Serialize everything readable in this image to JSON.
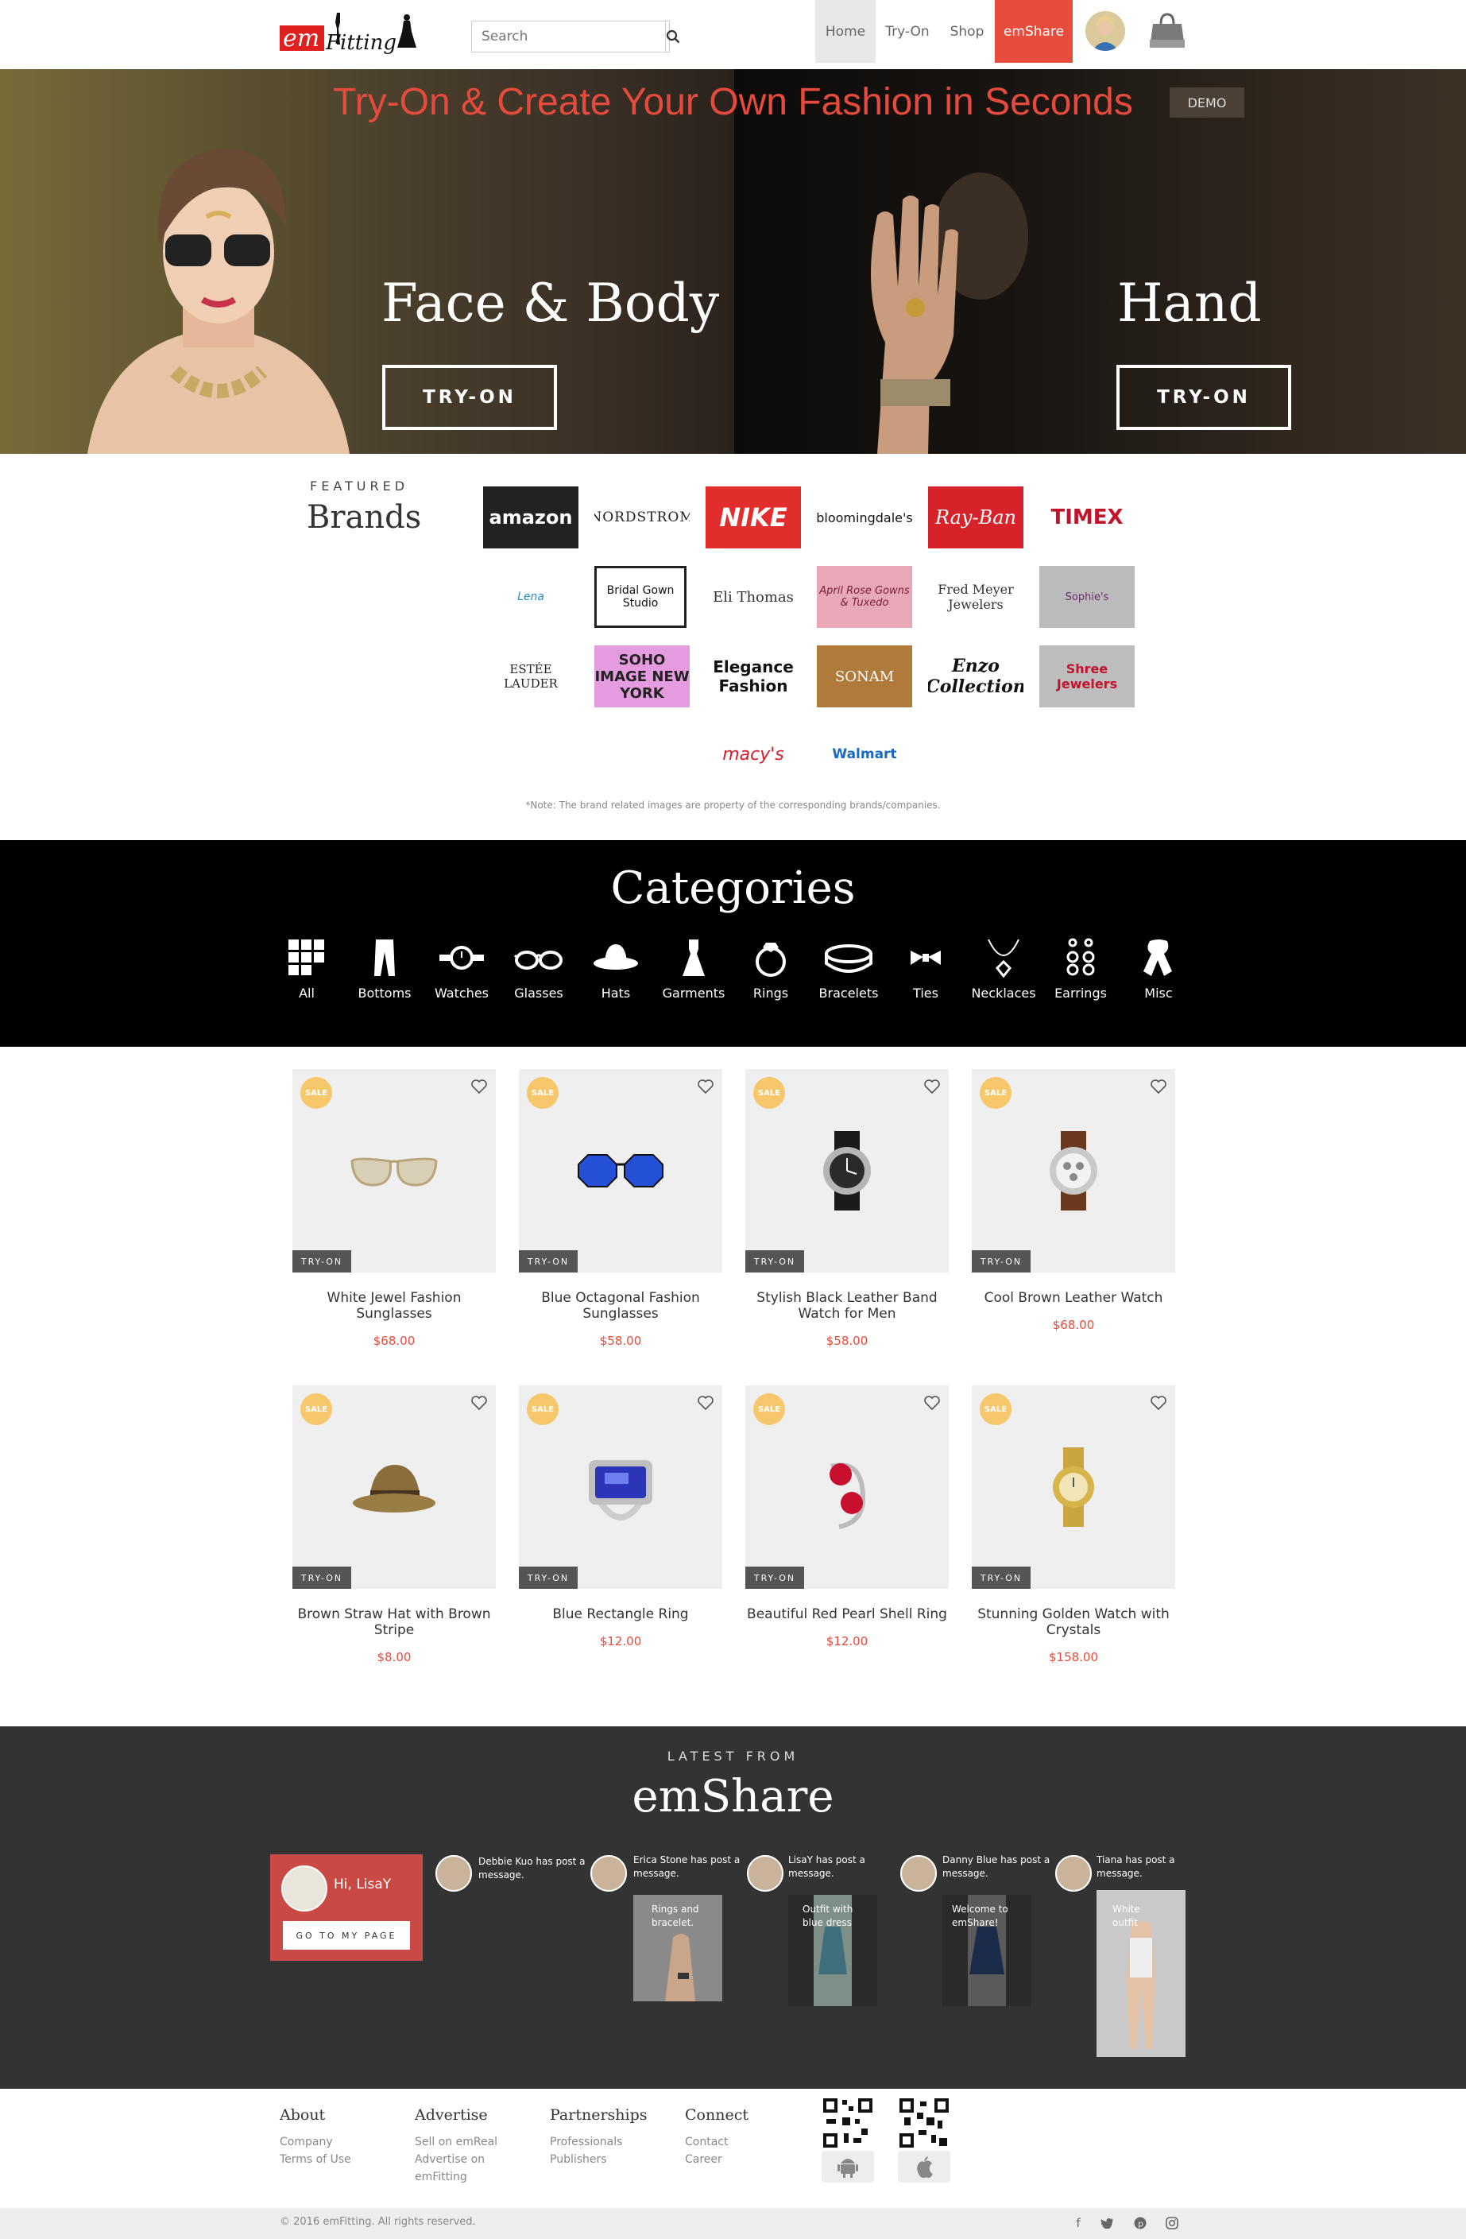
{
  "header": {
    "logo_text_a": "em",
    "logo_text_b": "Fitting",
    "search_placeholder": "Search",
    "nav": [
      "Home",
      "Try-On",
      "Shop",
      "emShare"
    ],
    "active_nav": "Home",
    "accent": "#e74c3c"
  },
  "hero": {
    "title": "Try-On & Create Your Own Fashion in Seconds",
    "demo": "DEMO",
    "left_heading": "Face & Body",
    "left_button": "TRY-ON",
    "right_heading": "Hand",
    "right_button": "TRY-ON"
  },
  "brands": {
    "featured_label": "FEATURED",
    "title": "Brands",
    "logos": [
      "amazon",
      "NORDSTROM",
      "NIKE",
      "bloomingdale's",
      "Ray-Ban",
      "TIMEX",
      "Lena",
      "Bridal Gown Studio",
      "Eli Thomas",
      "April Rose Gowns & Tuxedo",
      "Fred Meyer Jewelers",
      "Sophie's",
      "ESTÉE LAUDER",
      "SOHO IMAGE NEW YORK",
      "Elegance Fashion",
      "SONAM",
      "Enzo Collection",
      "Shree Jewelers",
      "macy's",
      "Walmart"
    ],
    "note": "*Note: The brand related images are property of the corresponding brands/companies."
  },
  "categories": {
    "title": "Categories",
    "items": [
      "All",
      "Bottoms",
      "Watches",
      "Glasses",
      "Hats",
      "Garments",
      "Rings",
      "Bracelets",
      "Ties",
      "Necklaces",
      "Earrings",
      "Misc"
    ]
  },
  "products": [
    {
      "name": "White Jewel Fashion Sunglasses",
      "price": "$68.00",
      "badge": "SALE",
      "button": "TRY-ON"
    },
    {
      "name": "Blue Octagonal Fashion Sunglasses",
      "price": "$58.00",
      "badge": "SALE",
      "button": "TRY-ON"
    },
    {
      "name": "Stylish Black Leather Band Watch for Men",
      "price": "$58.00",
      "badge": "SALE",
      "button": "TRY-ON"
    },
    {
      "name": "Cool Brown Leather Watch",
      "price": "$68.00",
      "badge": "SALE",
      "button": "TRY-ON"
    },
    {
      "name": "Brown Straw Hat with Brown Stripe",
      "price": "$8.00",
      "badge": "SALE",
      "button": "TRY-ON"
    },
    {
      "name": "Blue Rectangle Ring",
      "price": "$12.00",
      "badge": "SALE",
      "button": "TRY-ON"
    },
    {
      "name": "Beautiful Red Pearl Shell Ring",
      "price": "$12.00",
      "badge": "SALE",
      "button": "TRY-ON"
    },
    {
      "name": "Stunning Golden Watch with Crystals",
      "price": "$158.00",
      "badge": "SALE",
      "button": "TRY-ON"
    }
  ],
  "emshare": {
    "latest_label": "LATEST FROM",
    "title": "emShare",
    "greeting": "Hi, LisaY",
    "go_button": "GO TO MY PAGE",
    "posts": [
      {
        "author_text": "Debbie Kuo has post a message.",
        "quote": ""
      },
      {
        "author_text": "Erica Stone has post a message.",
        "quote": "Rings and bracelet."
      },
      {
        "author_text": "LisaY has post a message.",
        "quote": "Outfit with blue dress"
      },
      {
        "author_text": "Danny Blue has post a message.",
        "quote": "Welcome to emShare!"
      },
      {
        "author_text": "Tiana has post a message.",
        "quote": "White outfit"
      }
    ]
  },
  "footer": {
    "columns": [
      {
        "title": "About",
        "links": [
          "Company",
          "Terms of Use"
        ]
      },
      {
        "title": "Advertise",
        "links": [
          "Sell on emReal",
          "Advertise on emFitting"
        ]
      },
      {
        "title": "Partnerships",
        "links": [
          "Professionals",
          "Publishers"
        ]
      },
      {
        "title": "Connect",
        "links": [
          "Contact",
          "Career"
        ]
      }
    ],
    "copyright": "© 2016 emFitting. All rights reserved.",
    "social": [
      "facebook-icon",
      "twitter-icon",
      "pinterest-icon",
      "instagram-icon"
    ]
  }
}
